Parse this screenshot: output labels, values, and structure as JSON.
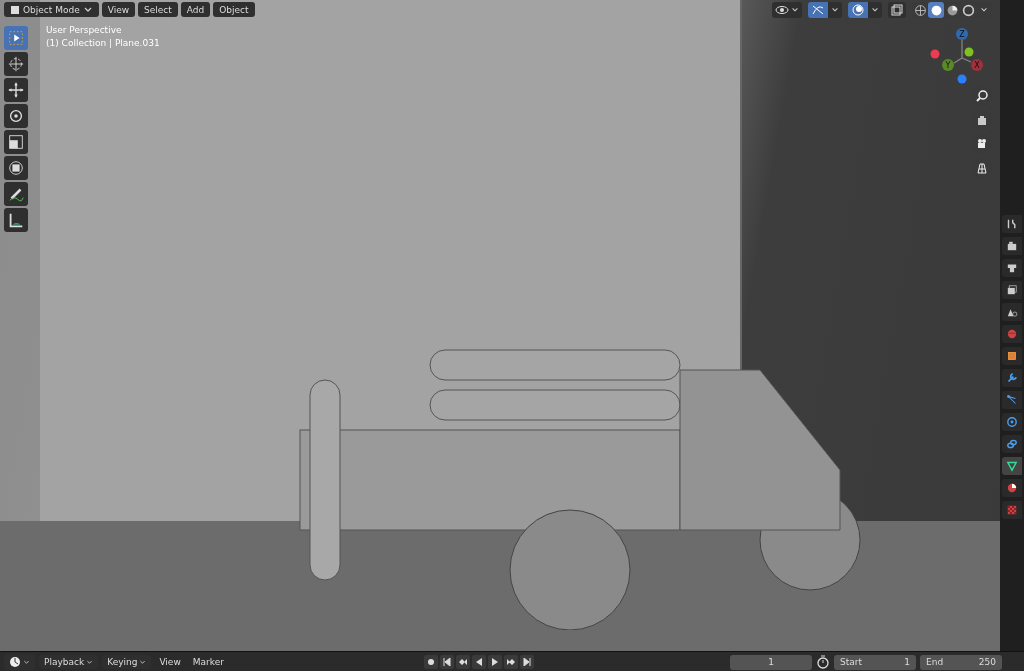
{
  "header": {
    "mode": "Object Mode",
    "menus": [
      "View",
      "Select",
      "Add",
      "Object"
    ],
    "shading": [
      {
        "kind": "wireframe",
        "selected": false
      },
      {
        "kind": "solid",
        "selected": true
      },
      {
        "kind": "material",
        "selected": false
      },
      {
        "kind": "rendered",
        "selected": false
      }
    ]
  },
  "overlay": {
    "view_name": "User Perspective",
    "object_info": "(1) Collection | Plane.031"
  },
  "gizmo": {
    "z": "Z",
    "y": "Y",
    "x": "X"
  },
  "toggles": [
    {
      "kind": "gizmos",
      "on": true
    },
    {
      "kind": "overlays",
      "on": true
    }
  ],
  "tools": [
    {
      "kind": "select",
      "selected": true
    },
    {
      "kind": "cursor",
      "selected": false
    },
    {
      "kind": "move",
      "selected": false
    },
    {
      "kind": "rotate",
      "selected": false
    },
    {
      "kind": "scale",
      "selected": false
    },
    {
      "kind": "transform",
      "selected": false
    },
    {
      "kind": "annotate",
      "selected": false
    },
    {
      "kind": "measure",
      "selected": false
    }
  ],
  "property_tabs": [
    {
      "kind": "tool",
      "selected": false
    },
    {
      "kind": "render",
      "selected": false
    },
    {
      "kind": "output",
      "selected": false
    },
    {
      "kind": "view-layer",
      "selected": false
    },
    {
      "kind": "scene",
      "selected": false
    },
    {
      "kind": "world",
      "selected": false
    },
    {
      "kind": "object",
      "selected": false
    },
    {
      "kind": "modifier",
      "selected": false
    },
    {
      "kind": "particles",
      "selected": false
    },
    {
      "kind": "physics",
      "selected": false
    },
    {
      "kind": "constraint",
      "selected": false
    },
    {
      "kind": "data",
      "selected": true
    },
    {
      "kind": "material",
      "selected": false
    },
    {
      "kind": "texture",
      "selected": false
    }
  ],
  "timeline": {
    "menus": [
      "Playback",
      "Keying",
      "View",
      "Marker"
    ],
    "current_frame": "1",
    "start_label": "Start",
    "start": "1",
    "end_label": "End",
    "end": "250"
  }
}
